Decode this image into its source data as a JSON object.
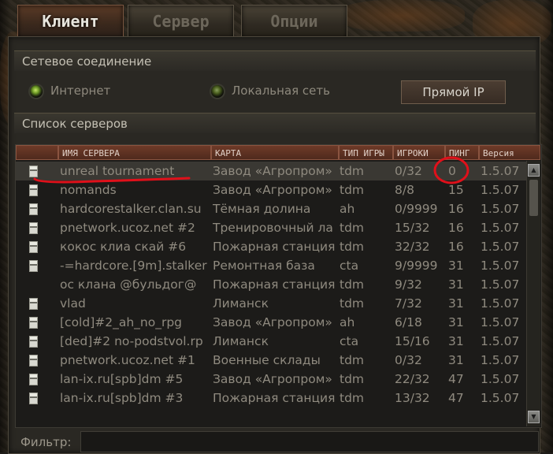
{
  "tabs": [
    {
      "label": "Клиент",
      "active": true
    },
    {
      "label": "Сервер",
      "active": false
    },
    {
      "label": "Опции",
      "active": false
    }
  ],
  "network": {
    "title": "Сетевое соединение",
    "internet_label": "Интернет",
    "lan_label": "Локальная сеть",
    "direct_ip_label": "Прямой IP"
  },
  "servers": {
    "title": "Список серверов",
    "columns": {
      "name": "ИМЯ СЕРВЕРА",
      "map": "КАРТА",
      "type": "ТИП ИГРЫ",
      "players": "ИГРОКИ",
      "ping": "ПИНГ",
      "version": "Версия"
    },
    "rows": [
      {
        "name": "unreal tournament",
        "map": "Завод «Агропром»",
        "type": "tdm",
        "players": "0/32",
        "ping": "0",
        "version": "1.5.07",
        "icon": "pc-icon"
      },
      {
        "name": "nomands",
        "map": "Завод «Агропром»",
        "type": "tdm",
        "players": "8/8",
        "ping": "15",
        "version": "1.5.07",
        "icon": "pc-icon"
      },
      {
        "name": "hardcorestalker.clan.su",
        "map": "Тёмная долина",
        "type": "ah",
        "players": "0/9999",
        "ping": "16",
        "version": "1.5.07",
        "icon": "pc-icon"
      },
      {
        "name": "pnetwork.ucoz.net #2",
        "map": "Тренировочный ла",
        "type": "tdm",
        "players": "15/32",
        "ping": "16",
        "version": "1.5.07",
        "icon": "pc-icon"
      },
      {
        "name": "кокос клиа скай #6",
        "map": "Пожарная станция",
        "type": "tdm",
        "players": "32/32",
        "ping": "16",
        "version": "1.5.07",
        "icon": "pc-icon"
      },
      {
        "name": "-=hardcore.[9m].stalker",
        "map": "Ремонтная база",
        "type": "cta",
        "players": "9/9999",
        "ping": "31",
        "version": "1.5.07",
        "icon": "pc-icon"
      },
      {
        "name": "ос клана @бульдог@",
        "map": "Пожарная станция",
        "type": "tdm",
        "players": "9/32",
        "ping": "31",
        "version": "1.5.07",
        "icon": ""
      },
      {
        "name": "vlad",
        "map": "Лиманск",
        "type": "tdm",
        "players": "7/32",
        "ping": "31",
        "version": "1.5.07",
        "icon": "pc-icon"
      },
      {
        "name": "[cold]#2_ah_no_rpg",
        "map": "Завод «Агропром»",
        "type": "ah",
        "players": "6/18",
        "ping": "31",
        "version": "1.5.07",
        "icon": "pc-icon"
      },
      {
        "name": "[ded]#2 no-podstvol.rp",
        "map": "Лиманск",
        "type": "cta",
        "players": "15/16",
        "ping": "31",
        "version": "1.5.07",
        "icon": "pc-icon"
      },
      {
        "name": "pnetwork.ucoz.net #1",
        "map": "Военные склады",
        "type": "tdm",
        "players": "0/32",
        "ping": "31",
        "version": "1.5.07",
        "icon": "pc-icon"
      },
      {
        "name": "lan-ix.ru[spb]dm #5",
        "map": "Завод «Агропром»",
        "type": "tdm",
        "players": "22/32",
        "ping": "47",
        "version": "1.5.07",
        "icon": "pc-icon"
      },
      {
        "name": "lan-ix.ru[spb]dm #3",
        "map": "Пожарная станция",
        "type": "tdm",
        "players": "13/32",
        "ping": "47",
        "version": "1.5.07",
        "icon": "pc-icon"
      }
    ]
  },
  "filter": {
    "label": "Фильтр:",
    "value": ""
  },
  "annotation_color": "#e0101a",
  "scrollbar": {
    "up_icon": "arrow-up-icon",
    "down_icon": "arrow-down-icon"
  }
}
